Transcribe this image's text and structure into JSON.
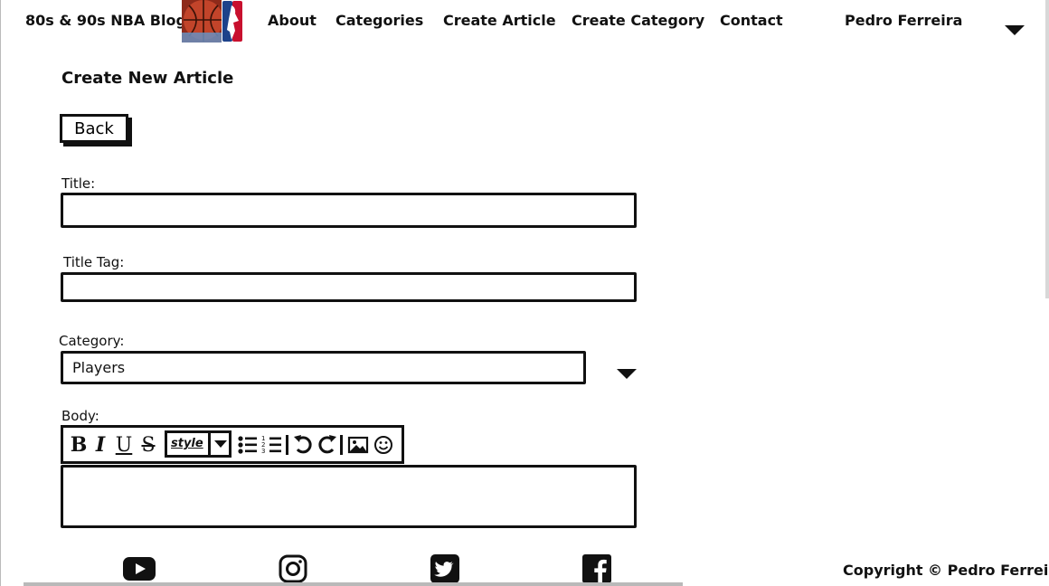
{
  "nav": {
    "brand": "80s & 90s NBA Blog",
    "links": [
      "About",
      "Categories",
      "Create Article",
      "Create Category",
      "Contact"
    ],
    "user_name": "Pedro Ferreira"
  },
  "page_title": "Create New Article",
  "back_label": "Back",
  "form": {
    "title_label": "Title:",
    "title_value": "",
    "title_tag_label": "Title Tag:",
    "title_tag_value": "",
    "category_label": "Category:",
    "category_value": "Players",
    "body_label": "Body:",
    "body_value": ""
  },
  "toolbar": {
    "bold": "B",
    "italic": "I",
    "underline": "U",
    "strike": "S",
    "style_label": "style"
  },
  "footer": {
    "social": [
      "youtube-icon",
      "instagram-icon",
      "twitter-icon",
      "facebook-icon"
    ],
    "copyright": "Copyright © Pedro Ferreira"
  }
}
